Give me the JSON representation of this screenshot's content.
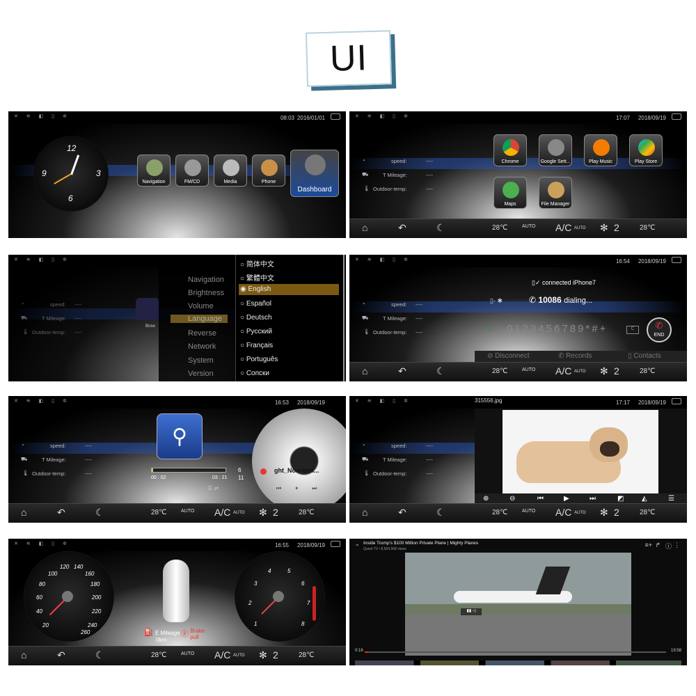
{
  "title": "UI",
  "p1": {
    "time": "08:03",
    "date": "2016/01/01",
    "apps": [
      "Navigation",
      "FM/CD",
      "Media",
      "Phone"
    ],
    "dashboard": "Dashboard",
    "clock": {
      "twelve": "12",
      "nine": "9",
      "three": "3",
      "six": "6"
    }
  },
  "p2": {
    "time": "17:07",
    "date": "2018/09/19",
    "apps": [
      "Chrome",
      "Google Sett...",
      "Play Music",
      "Play Store",
      "Maps",
      "File Manager"
    ]
  },
  "info": {
    "speed": "speed:",
    "speed_v": "----",
    "mileage": "T Mileage:",
    "mileage_v": "----",
    "temp": "Outdoor-temp:",
    "temp_v": "----"
  },
  "bottombar": {
    "t1": "28℃",
    "auto": "AUTO",
    "ac": "A/C",
    "ac_sub": "AUTO",
    "fan": "2",
    "t2": "28℃"
  },
  "p3": {
    "menu": [
      "Navigation",
      "Brightness",
      "Volume",
      "Language",
      "Reverse",
      "Network",
      "System",
      "Version"
    ],
    "langs": [
      "简体中文",
      "繁體中文",
      "English",
      "Español",
      "Deutsch",
      "Русский",
      "Français",
      "Português",
      "Сопски"
    ],
    "browser": "Brow"
  },
  "p4": {
    "time": "16:54",
    "date": "2018/09/19",
    "connected": "connected iPhone7",
    "number": "10086",
    "dialing": "dialing...",
    "digits": "0123456789*#+",
    "end": "END",
    "disconnect": "Disconnect",
    "records": "Records",
    "contacts": "Contacts"
  },
  "p5": {
    "time": "16:53",
    "date": "2018/09/19",
    "elapsed": "00 : 02",
    "total": "03 : 21",
    "track_num": "6",
    "track_total": "11",
    "song": "ght_Now-ben..."
  },
  "p6": {
    "time": "17:17",
    "date": "2018/09/19",
    "filename": "315556.jpg"
  },
  "p7": {
    "time": "16:55",
    "date": "2018/09/19",
    "speeds": [
      "20",
      "40",
      "60",
      "80",
      "100",
      "120",
      "140",
      "160",
      "180",
      "200",
      "220",
      "240",
      "260"
    ],
    "rpm": [
      "1",
      "2",
      "3",
      "4",
      "5",
      "6",
      "7",
      "8"
    ],
    "mileage_label": "E Mileage",
    "mileage_val": "0km",
    "brake": "Brake pull"
  },
  "p8": {
    "title": "Inside Trump's $100 Million Private Plane | Mighty Planes",
    "sub": "Quest TV • 8,504,568 views",
    "elapsed": "0:16",
    "total": "19:58"
  },
  "colors": {
    "accent": "#1f5fbf",
    "brand": "#3d6f8a",
    "brake": "#e33"
  }
}
